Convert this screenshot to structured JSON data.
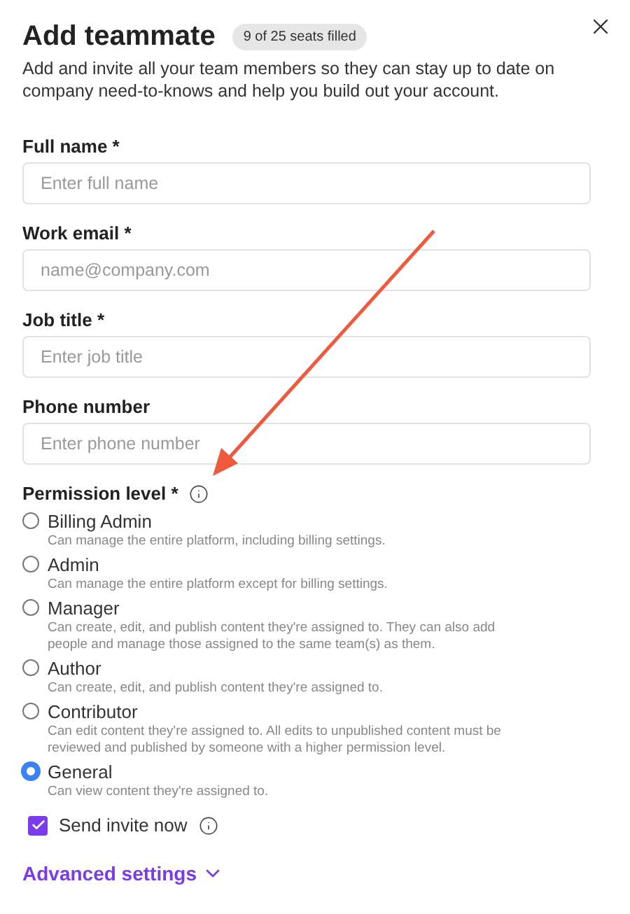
{
  "title": "Add teammate",
  "seats_badge": "9 of 25 seats filled",
  "description": "Add and invite all your team members so they can stay up to date on company need-to-knows and help you build out your account.",
  "fields": [
    {
      "label": "Full name *",
      "placeholder": "Enter full name"
    },
    {
      "label": "Work email *",
      "placeholder": "name@company.com"
    },
    {
      "label": "Job title *",
      "placeholder": "Enter job title"
    },
    {
      "label": "Phone number",
      "placeholder": "Enter phone number"
    }
  ],
  "permission": {
    "label": "Permission level *",
    "options": [
      {
        "label": "Billing Admin",
        "description": "Can manage the entire platform, including billing settings.",
        "selected": false
      },
      {
        "label": "Admin",
        "description": "Can manage the entire platform except for billing settings.",
        "selected": false
      },
      {
        "label": "Manager",
        "description": "Can create, edit, and publish content they're assigned to. They can also add people and manage those assigned to the same team(s) as them.",
        "selected": false
      },
      {
        "label": "Author",
        "description": "Can create, edit, and publish content they're assigned to.",
        "selected": false
      },
      {
        "label": "Contributor",
        "description": "Can edit content they're assigned to. All edits to unpublished content must be reviewed and published by someone with a higher permission level.",
        "selected": false
      },
      {
        "label": "General",
        "description": "Can view content they're assigned to.",
        "selected": true
      }
    ]
  },
  "send_invite": {
    "label": "Send invite now",
    "checked": true
  },
  "advanced_link": "Advanced settings"
}
